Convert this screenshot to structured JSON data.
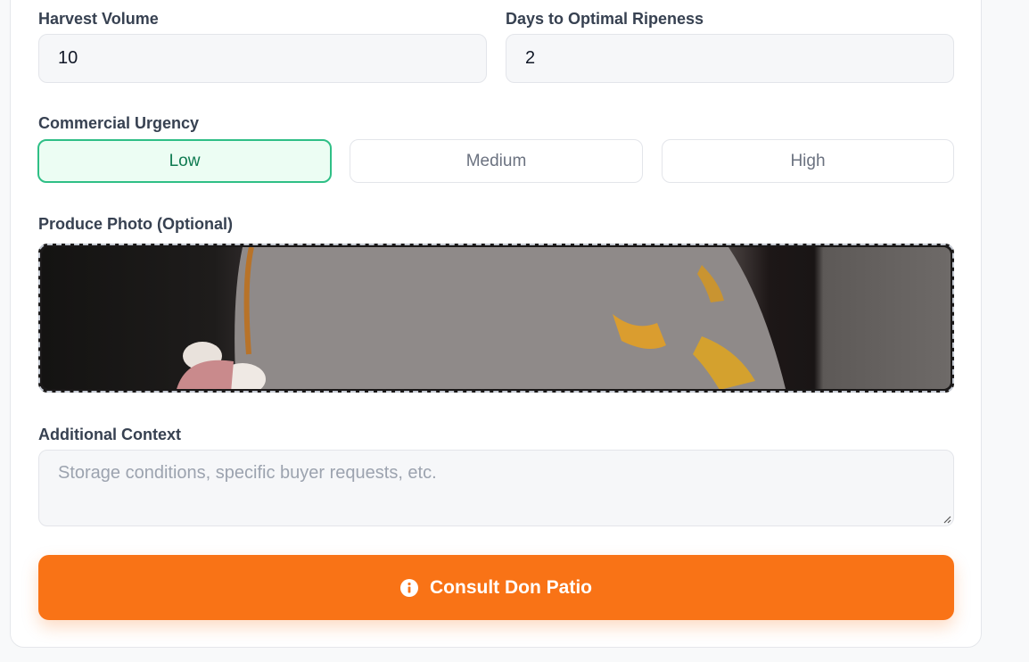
{
  "form": {
    "harvest_volume_label": "Harvest Volume",
    "harvest_volume_value": "10",
    "days_label": "Days to Optimal Ripeness",
    "days_value": "2",
    "urgency_label": "Commercial Urgency",
    "urgency_options": [
      "Low",
      "Medium",
      "High"
    ],
    "urgency_selected": "Low",
    "photo_label": "Produce Photo (Optional)",
    "context_label": "Additional Context",
    "context_placeholder": "Storage conditions, specific buyer requests, etc.",
    "submit_label": "Consult Don Patio",
    "submit_icon": "info-circle-icon"
  },
  "colors": {
    "accent": "#f97316",
    "selected_border": "#2fbf86",
    "selected_bg": "#ecfdf3",
    "selected_text": "#0f7a50"
  }
}
